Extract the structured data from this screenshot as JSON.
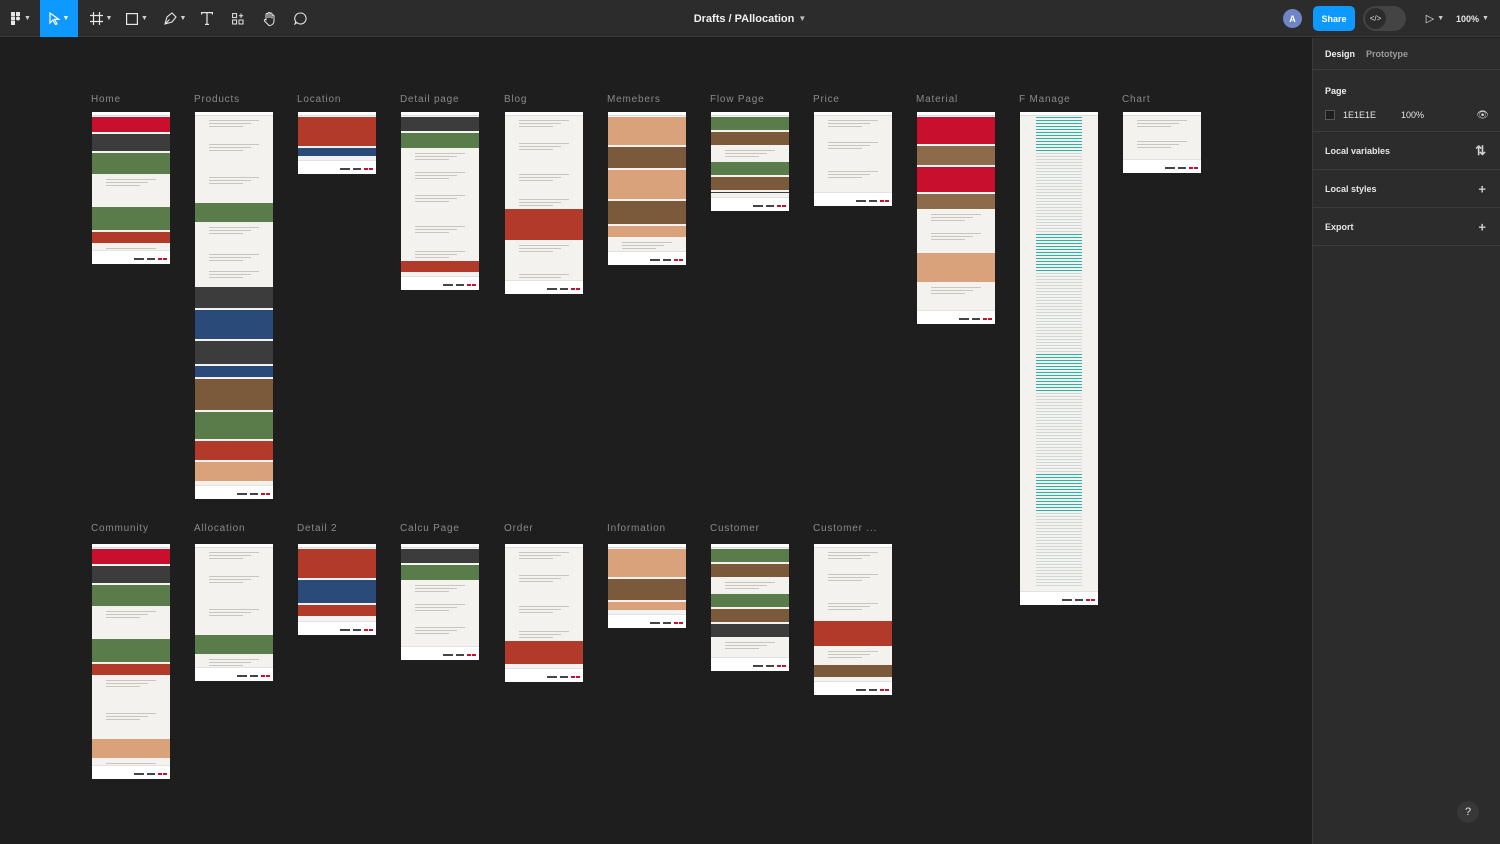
{
  "toolbar": {
    "breadcrumb": "Drafts / PAllocation",
    "avatar_initial": "A",
    "share_label": "Share",
    "dev_mode_glyph": "</>",
    "zoom": "100%",
    "tools": [
      "main-menu-icon",
      "move-tool-icon",
      "frame-tool-icon",
      "shape-tool-icon",
      "pen-tool-icon",
      "text-tool-icon",
      "resources-icon",
      "hand-tool-icon",
      "comment-tool-icon"
    ]
  },
  "canvas": {
    "frames_row1": [
      "Home",
      "Products",
      "Location",
      "Detail page",
      "Blog",
      "Memebers",
      "Flow Page",
      "Price",
      "Material",
      "F Manage",
      "Chart"
    ],
    "frames_row2": [
      "Community",
      "Allocation",
      "Detail 2",
      "Calcu Page",
      "Order",
      "Information",
      "Customer",
      "Customer ..."
    ]
  },
  "panel": {
    "tabs": [
      "Design",
      "Prototype"
    ],
    "page_heading": "Page",
    "page_color": "1E1E1E",
    "page_opacity": "100%",
    "sections": [
      "Local variables",
      "Local styles",
      "Export"
    ]
  },
  "help_label": "?",
  "colors": {
    "accent": "#0d99ff",
    "canvas": "#1e1e1e",
    "panel": "#2c2c2c",
    "brand_red": "#c8102e",
    "teal": "#2bb3a3"
  }
}
